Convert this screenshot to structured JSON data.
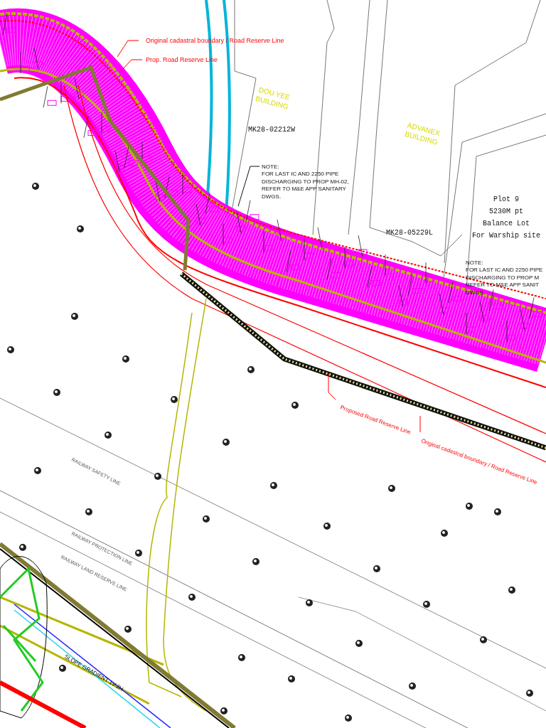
{
  "drawing": {
    "annotations": [
      {
        "kind": "red-label",
        "lines": [
          "Original cadastral boundary / Road Reserve Line"
        ]
      },
      {
        "kind": "red-label",
        "lines": [
          "Prop. Road Reserve Line"
        ]
      },
      {
        "kind": "building-label",
        "lines": [
          "DOU YEE",
          "BUILDING"
        ]
      },
      {
        "kind": "lot-label",
        "lines": [
          "MK28-02212W"
        ]
      },
      {
        "kind": "note",
        "lines": [
          "NOTE:",
          "FOR LAST IC AND 2250 PIPE",
          "DISCHARGING TO PROP MH-02,",
          "REFER TO M&E APP SANITARY",
          "DWGS."
        ]
      },
      {
        "kind": "building-label",
        "lines": [
          "ADVANEX",
          "BUILDING"
        ]
      },
      {
        "kind": "lot-label",
        "lines": [
          "MK28-05229L"
        ]
      },
      {
        "kind": "lot-label",
        "lines": [
          "Plot 9",
          "5230M pt",
          "Balance Lot",
          "For Warship site"
        ]
      },
      {
        "kind": "note",
        "lines": [
          "NOTE:",
          "FOR LAST IC AND 2250 PIPE",
          "DISCHARGING TO PROP M",
          "REFER TO M&E APP SANIT",
          "DWGS."
        ]
      },
      {
        "kind": "red-label",
        "lines": [
          "Proposed Road Reserve Line"
        ]
      },
      {
        "kind": "red-label",
        "lines": [
          "Original cadastral boundary / Road Reserve Line"
        ]
      },
      {
        "kind": "railway-label",
        "lines": [
          "RAILWAY SAFETY LINE"
        ]
      },
      {
        "kind": "railway-label",
        "lines": [
          "RAILWAY PROTECTION LINE"
        ]
      },
      {
        "kind": "railway-label",
        "lines": [
          "RAILWAY LAND RESERVE LINE"
        ]
      },
      {
        "kind": "slope-label",
        "lines": [
          "SLOPE GRADIENT 1V:2H"
        ]
      }
    ]
  }
}
